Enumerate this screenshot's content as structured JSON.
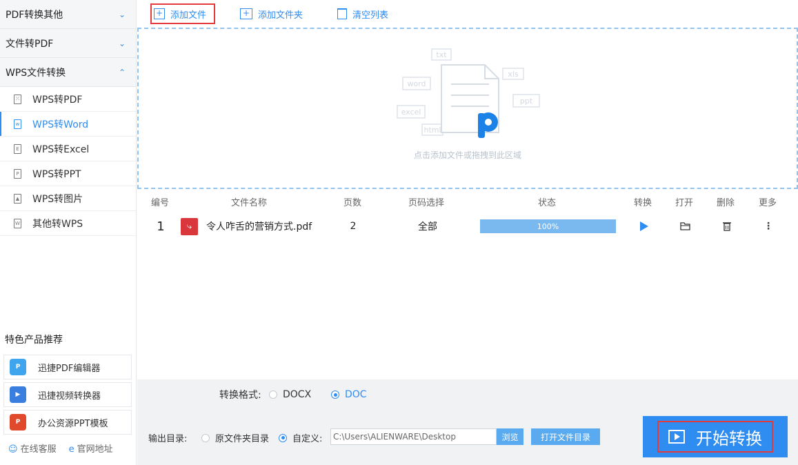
{
  "sidebar": {
    "groups": [
      {
        "label": "PDF转换其他",
        "state": "collapsed"
      },
      {
        "label": "文件转PDF",
        "state": "collapsed"
      },
      {
        "label": "WPS文件转换",
        "state": "expanded"
      }
    ],
    "sub_items": [
      {
        "label": "WPS转PDF",
        "icon": "pdf-doc-icon"
      },
      {
        "label": "WPS转Word",
        "icon": "word-doc-icon",
        "active": true
      },
      {
        "label": "WPS转Excel",
        "icon": "excel-doc-icon"
      },
      {
        "label": "WPS转PPT",
        "icon": "ppt-doc-icon"
      },
      {
        "label": "WPS转图片",
        "icon": "image-doc-icon"
      },
      {
        "label": "其他转WPS",
        "icon": "wps-doc-icon"
      }
    ],
    "featured_title": "特色产品推荐",
    "products": [
      {
        "label": "迅捷PDF编辑器",
        "icon": "pdf-editor-icon"
      },
      {
        "label": "迅捷视频转换器",
        "icon": "video-converter-icon"
      },
      {
        "label": "办公资源PPT模板",
        "icon": "ppt-template-icon"
      }
    ],
    "links": {
      "support": "在线客服",
      "website": "官网地址"
    }
  },
  "toolbar": {
    "add_file": "添加文件",
    "add_folder": "添加文件夹",
    "clear_list": "清空列表"
  },
  "dropzone": {
    "hint": "点击添加文件或拖拽到此区域",
    "file_tags": [
      "txt",
      "xls",
      "word",
      "ppt",
      "excel",
      "html"
    ]
  },
  "table": {
    "headers": {
      "index": "编号",
      "name": "文件名称",
      "pages": "页数",
      "page_select": "页码选择",
      "status": "状态",
      "convert": "转换",
      "open": "打开",
      "delete": "删除",
      "more": "更多"
    },
    "rows": [
      {
        "index": "1",
        "name": "令人咋舌的营销方式.pdf",
        "pages": "2",
        "page_select": "全部",
        "progress": "100%"
      }
    ]
  },
  "format": {
    "label": "转换格式:",
    "options": [
      "DOCX",
      "DOC"
    ],
    "selected": "DOC"
  },
  "output": {
    "label": "输出目录:",
    "option_original": "原文件夹目录",
    "option_custom": "自定义:",
    "selected": "custom",
    "path": "C:\\Users\\ALIENWARE\\Desktop",
    "browse": "浏览",
    "open_folder": "打开文件目录"
  },
  "start_button": "开始转换",
  "colors": {
    "accent": "#2f8cf0",
    "highlight": "#e33b3b",
    "progress": "#7ab9f0",
    "pdf_red": "#d9373b"
  }
}
